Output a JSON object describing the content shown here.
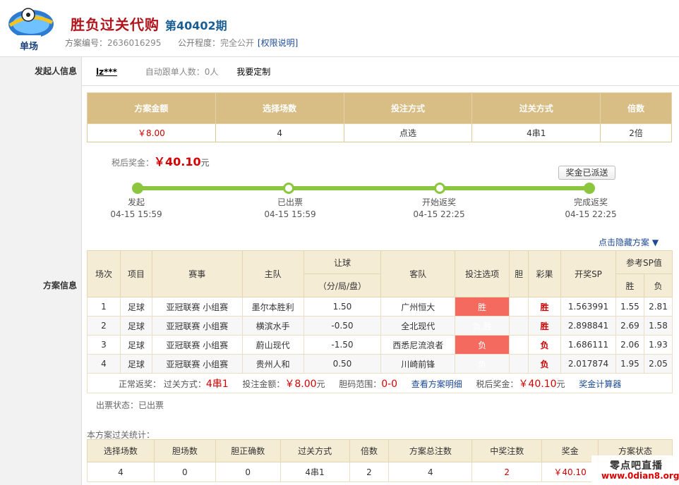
{
  "header": {
    "logo_text": "单场",
    "title": "胜负过关代购",
    "issue": "第40402期",
    "plan_id_label": "方案编号：",
    "plan_id": "2636016295",
    "visibility_label": "公开程度：",
    "visibility": "完全公开",
    "permission_link": "[权限说明]"
  },
  "sponsor": {
    "label": "发起人信息",
    "user": "lz***",
    "auto_follow": "自动跟单人数：0人",
    "custom_link": "我要定制"
  },
  "plan_label": "方案信息",
  "summary": {
    "headers": [
      "方案金额",
      "选择场数",
      "投注方式",
      "过关方式",
      "倍数"
    ],
    "values": [
      "￥8.00",
      "4",
      "点选",
      "4串1",
      "2倍"
    ]
  },
  "prize": {
    "label": "税后奖金：",
    "amount": "￥40.10",
    "unit": "元",
    "sent_button": "奖金已派送"
  },
  "progress_steps": [
    {
      "label": "发起",
      "time": "04-15 15:59"
    },
    {
      "label": "已出票",
      "time": "04-15 15:59"
    },
    {
      "label": "开始返奖",
      "time": "04-15 22:25"
    },
    {
      "label": "完成返奖",
      "time": "04-15 22:25"
    }
  ],
  "toggle_plan": "点击隐藏方案 ▼",
  "detail": {
    "headers": {
      "no": "场次",
      "item": "项目",
      "event": "赛事",
      "home": "主队",
      "handicap": "让球",
      "handicap_sub": "（分/局/盘）",
      "away": "客队",
      "pick": "投注选项",
      "banker": "胆",
      "result": "彩果",
      "sp": "开奖SP",
      "ref_sp": "参考SP值",
      "win": "胜",
      "lose": "负"
    },
    "rows": [
      {
        "no": "1",
        "item": "足球",
        "event": "亚冠联赛 小组赛",
        "home": "墨尔本胜利",
        "handicap": "1.50",
        "away": "广州恒大",
        "pick": "胜",
        "banker": "",
        "result": "胜",
        "sp": "1.563991",
        "win": "1.55",
        "lose": "2.81"
      },
      {
        "no": "2",
        "item": "足球",
        "event": "亚冠联赛 小组赛",
        "home": "横滨水手",
        "handicap": "-0.50",
        "away": "全北现代",
        "pick": "负,胜",
        "banker": "",
        "result": "胜",
        "sp": "2.898841",
        "win": "2.69",
        "lose": "1.58"
      },
      {
        "no": "3",
        "item": "足球",
        "event": "亚冠联赛 小组赛",
        "home": "蔚山现代",
        "handicap": "-1.50",
        "away": "西悉尼流浪者",
        "pick": "负",
        "banker": "",
        "result": "负",
        "sp": "1.686111",
        "win": "2.06",
        "lose": "1.93"
      },
      {
        "no": "4",
        "item": "足球",
        "event": "亚冠联赛 小组赛",
        "home": "贵州人和",
        "handicap": "0.50",
        "away": "川崎前锋",
        "pick": "负",
        "banker": "",
        "result": "负",
        "sp": "2.017874",
        "win": "1.95",
        "lose": "2.05"
      }
    ],
    "footer": {
      "normal_label": "正常返奖：",
      "pass_label": "过关方式：",
      "pass_value": "4串1",
      "amount_label": "投注金额：",
      "amount_value": "￥8.00",
      "amount_unit": "元",
      "banker_label": "胆码范围：",
      "banker_value": "0-0",
      "detail_link": "查看方案明细",
      "prize_label": "税后奖金：",
      "prize_value": "￥40.10",
      "prize_unit": "元",
      "calc_link": "奖金计算器"
    }
  },
  "ticket_status": "出票状态：已出票",
  "stats": {
    "title": "本方案过关统计：",
    "headers": [
      "选择场数",
      "胆场数",
      "胆正确数",
      "过关方式",
      "倍数",
      "方案总注数",
      "中奖注数",
      "奖金",
      "方案状态"
    ],
    "values": [
      "4",
      "0",
      "0",
      "4串1",
      "2",
      "4",
      "2",
      "￥40.10",
      ""
    ]
  },
  "watermark": {
    "line1": "零点吧直播",
    "line2": "www.0dian8.org"
  },
  "colors": {
    "header_gold": "#d8bd84",
    "accent_red": "#d40000",
    "progress_green": "#8cc63f",
    "pick_red": "#f46a5e",
    "link_blue": "#1c4a94"
  }
}
